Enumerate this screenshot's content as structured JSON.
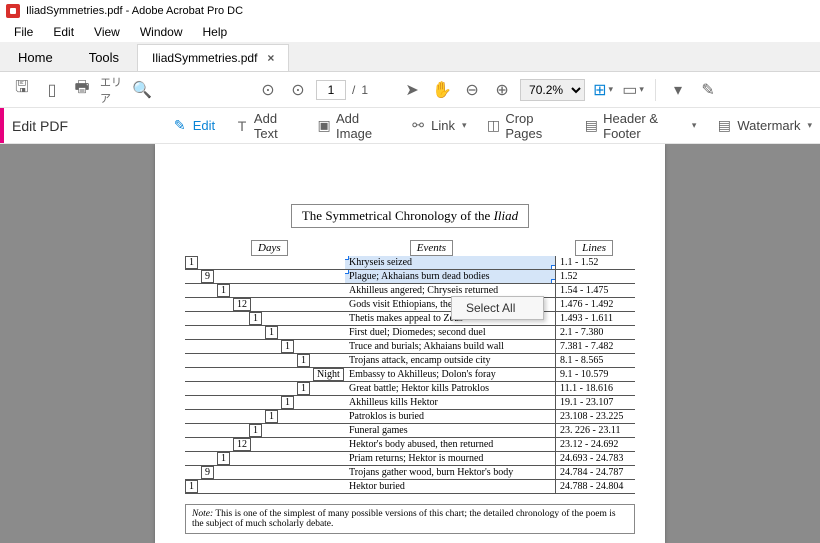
{
  "titlebar": {
    "text": "IliadSymmetries.pdf - Adobe Acrobat Pro DC"
  },
  "menubar": {
    "file": "File",
    "edit": "Edit",
    "view": "View",
    "window": "Window",
    "help": "Help"
  },
  "tabs": {
    "home": "Home",
    "tools": "Tools",
    "doc": "IliadSymmetries.pdf"
  },
  "toolbar": {
    "page_cur": "1",
    "page_sep": "/",
    "page_total": "1",
    "zoom": "70.2%"
  },
  "editbar": {
    "title": "Edit PDF",
    "edit": "Edit",
    "addtext": "Add Text",
    "addimage": "Add Image",
    "link": "Link",
    "crop": "Crop Pages",
    "header": "Header & Footer",
    "watermark": "Watermark"
  },
  "ctx_menu": {
    "select_all": "Select All"
  },
  "doc": {
    "title_pre": "The Symmetrical Chronology of the ",
    "title_ital": "Iliad",
    "hdr_days": "Days",
    "hdr_events": "Events",
    "hdr_lines": "Lines",
    "rows": [
      {
        "d": "1",
        "ind": 0,
        "e": "Khryseis seized",
        "l": "1.1 - 1.52",
        "sel": true
      },
      {
        "d": "9",
        "ind": 1,
        "e": "Plague; Akhaians burn dead bodies",
        "l": "1.52",
        "sel": true
      },
      {
        "d": "1",
        "ind": 2,
        "e": "Akhilleus angered; Chryseis returned",
        "l": "1.54 - 1.475",
        "partial": true
      },
      {
        "d": "12",
        "ind": 3,
        "e": "Gods visit Ethiopians, then return",
        "l": "1.476 - 1.492"
      },
      {
        "d": "1",
        "ind": 4,
        "e": "Thetis makes appeal to Zeus",
        "l": "1.493 - 1.611"
      },
      {
        "d": "1",
        "ind": 5,
        "e": "First duel; Diomedes; second duel",
        "l": "2.1 - 7.380"
      },
      {
        "d": "1",
        "ind": 6,
        "e": "Truce and burials; Akhaians build wall",
        "l": "7.381 - 7.482"
      },
      {
        "d": "1",
        "ind": 7,
        "e": "Trojans attack, encamp outside city",
        "l": "8.1 - 8.565"
      },
      {
        "d": "Night",
        "ind": 8,
        "e": "Embassy to Akhilleus; Dolon's foray",
        "l": "9.1 - 10.579"
      },
      {
        "d": "1",
        "ind": 7,
        "e": "Great battle; Hektor kills Patroklos",
        "l": "11.1 - 18.616"
      },
      {
        "d": "1",
        "ind": 6,
        "e": "Akhilleus kills Hektor",
        "l": "19.1 - 23.107"
      },
      {
        "d": "1",
        "ind": 5,
        "e": "Patroklos is buried",
        "l": "23.108 - 23.225"
      },
      {
        "d": "1",
        "ind": 4,
        "e": "Funeral games",
        "l": "23. 226 - 23.11"
      },
      {
        "d": "12",
        "ind": 3,
        "e": "Hektor's body abused, then returned",
        "l": "23.12 - 24.692"
      },
      {
        "d": "1",
        "ind": 2,
        "e": "Priam returns; Hektor is mourned",
        "l": "24.693 - 24.783"
      },
      {
        "d": "9",
        "ind": 1,
        "e": "Trojans gather wood, burn Hektor's body",
        "l": "24.784 - 24.787"
      },
      {
        "d": "1",
        "ind": 0,
        "e": "Hektor buried",
        "l": "24.788 - 24.804"
      }
    ],
    "note_label": "Note:",
    "note_text": " This is one of the simplest of many possible versions of this chart; the detailed chronology of the poem is the subject of much scholarly debate."
  }
}
